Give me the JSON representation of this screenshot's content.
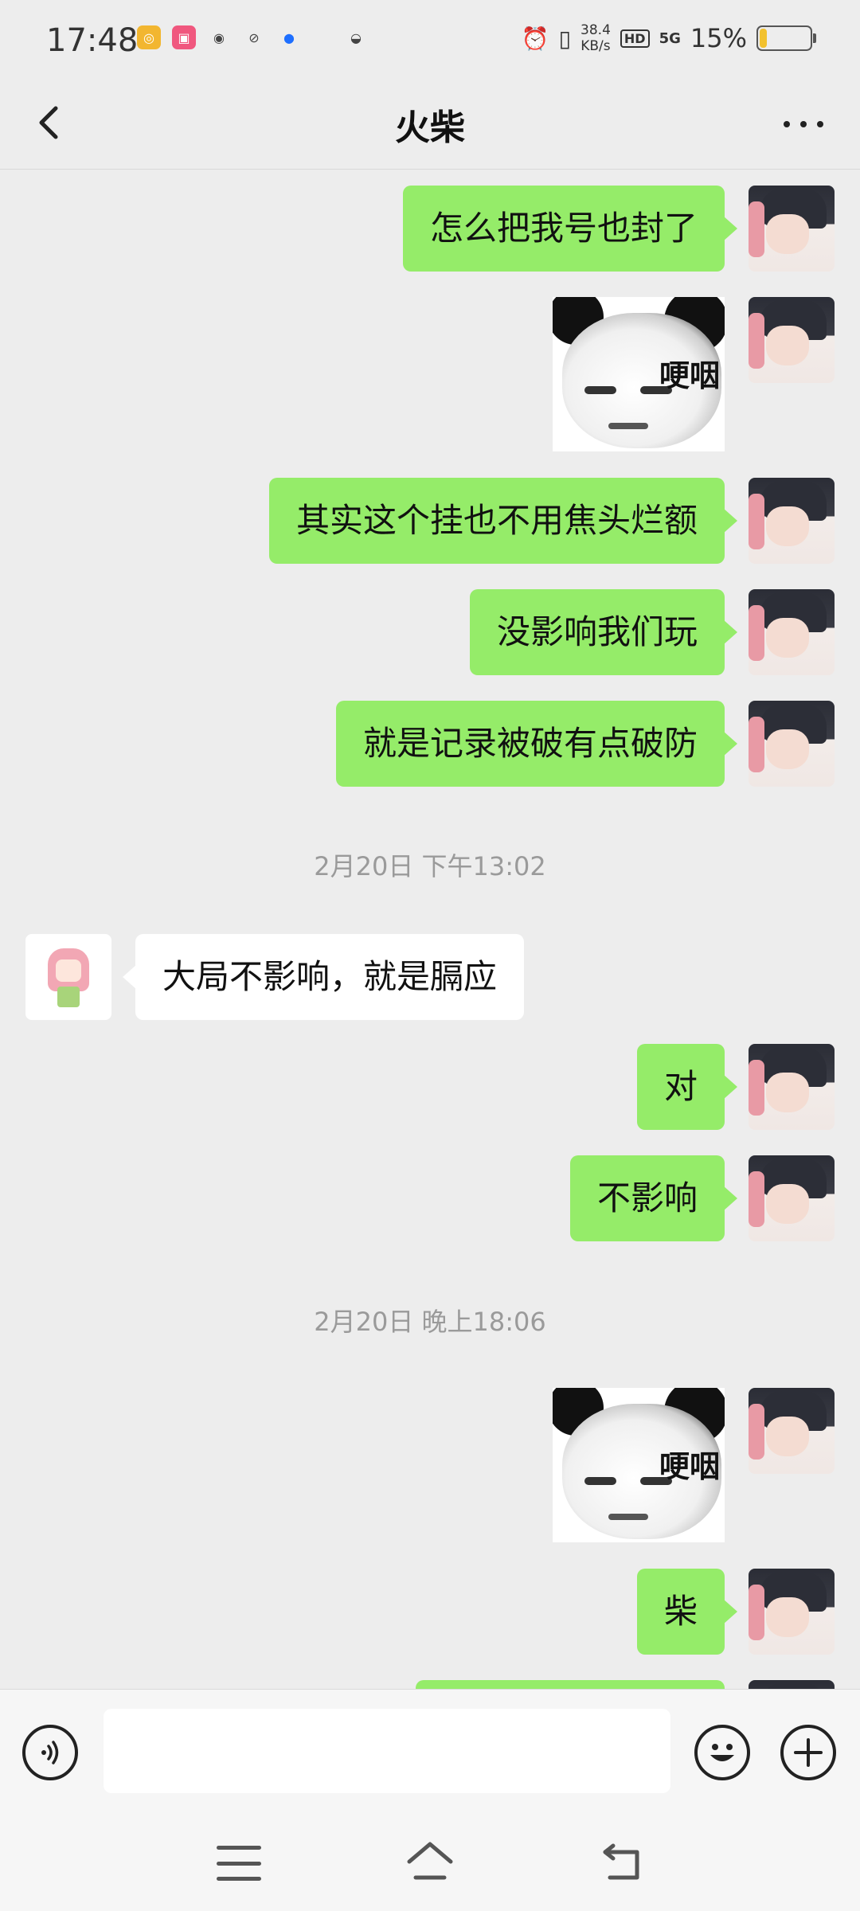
{
  "status_bar": {
    "time": "17:48",
    "net_speed_top": "38.4",
    "net_speed_bottom": "KB/s",
    "hd": "HD",
    "signal": "5G",
    "battery_percent": "15%",
    "battery_level": 0.15,
    "battery_color": "#F2C12E",
    "app_icons": [
      "app-icon-1",
      "app-icon-2",
      "app-icon-3",
      "app-icon-4",
      "app-icon-5",
      "app-icon-6"
    ]
  },
  "navbar": {
    "title": "火柴"
  },
  "messages": [
    {
      "side": "me",
      "type": "text",
      "text": "怎么把我号也封了"
    },
    {
      "side": "me",
      "type": "sticker",
      "text": "哽咽"
    },
    {
      "side": "me",
      "type": "text",
      "text": "其实这个挂也不用焦头烂额"
    },
    {
      "side": "me",
      "type": "text",
      "text": "没影响我们玩"
    },
    {
      "side": "me",
      "type": "text",
      "text": "就是记录被破有点破防"
    },
    {
      "type": "timestamp",
      "text": "2月20日 下午13:02"
    },
    {
      "side": "other",
      "type": "text",
      "text": "大局不影响，就是膈应"
    },
    {
      "side": "me",
      "type": "text",
      "text": "对"
    },
    {
      "side": "me",
      "type": "text",
      "text": "不影响"
    },
    {
      "type": "timestamp",
      "text": "2月20日 晚上18:06"
    },
    {
      "side": "me",
      "type": "sticker",
      "text": "哽咽"
    },
    {
      "side": "me",
      "type": "text",
      "text": "柴"
    }
  ],
  "input_bar": {
    "value": "",
    "voice_icon": "voice-icon",
    "emoji_icon": "emoji-icon",
    "plus_icon": "plus-icon"
  },
  "colors": {
    "my_bubble": "#95EC69",
    "other_bubble": "#FFFFFF",
    "background": "#EDEDED"
  }
}
